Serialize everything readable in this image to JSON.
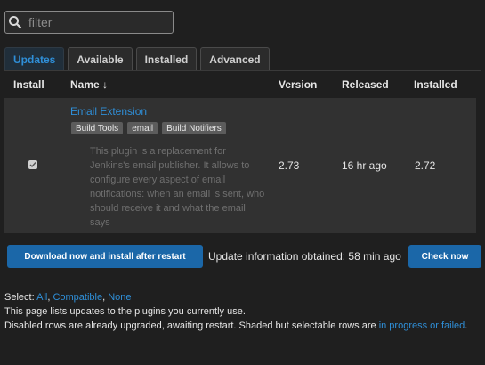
{
  "filter": {
    "placeholder": "filter"
  },
  "tabs": [
    {
      "label": "Updates",
      "active": true
    },
    {
      "label": "Available",
      "active": false
    },
    {
      "label": "Installed",
      "active": false
    },
    {
      "label": "Advanced",
      "active": false
    }
  ],
  "table": {
    "headers": {
      "install": "Install",
      "name": "Name ↓",
      "version": "Version",
      "released": "Released",
      "installed": "Installed"
    },
    "rows": [
      {
        "checked": true,
        "name": "Email Extension",
        "labels": [
          "Build Tools",
          "email",
          "Build Notifiers"
        ],
        "description": "This plugin is a replacement for Jenkins's email publisher. It allows to configure every aspect of email notifications: when an email is sent, who should receive it and what the email says",
        "version": "2.73",
        "released": "16 hr ago",
        "installed": "2.72"
      }
    ]
  },
  "actions": {
    "download_label": "Download now and install after restart",
    "update_info": "Update information obtained: 58 min ago",
    "check_now_label": "Check now"
  },
  "footer": {
    "select_prefix": "Select:",
    "all": "All",
    "compatible": "Compatible",
    "none": "None",
    "sep": ",",
    "line2": "This page lists updates to the plugins you currently use.",
    "line3_prefix": "Disabled rows are already upgraded, awaiting restart. Shaded but selectable rows are",
    "line3_link": "in progress or failed",
    "line3_suffix": "."
  },
  "colors": {
    "accent": "#2f8fd8",
    "button": "#1b67a8",
    "background": "#1f1f1f",
    "row": "#313131"
  },
  "icons": {
    "search": "search-icon",
    "checkbox": "checkbox-icon",
    "sort": "sort-arrow-icon"
  }
}
